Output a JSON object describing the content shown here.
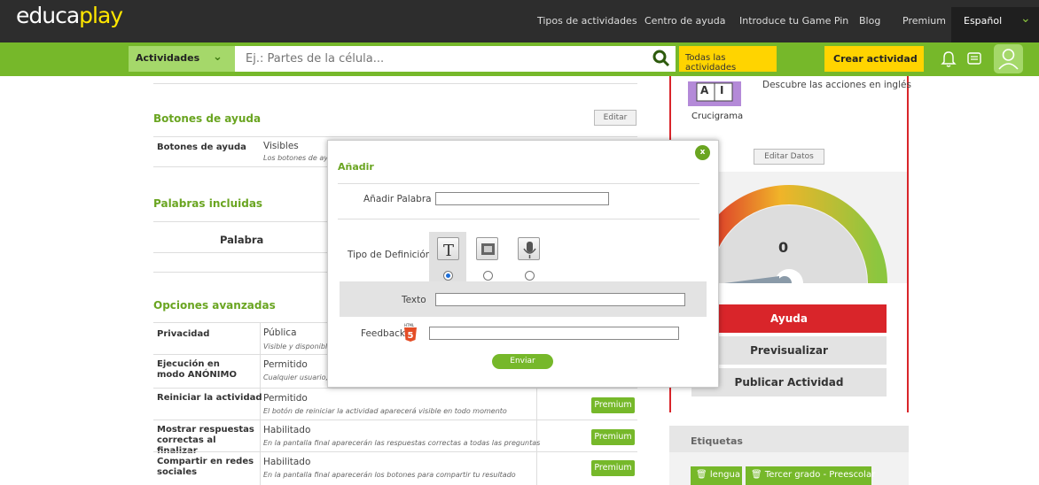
{
  "topbar": {
    "links": [
      "Tipos de actividades",
      "Centro de ayuda",
      "Introduce tu Game Pin",
      "Blog",
      "Premium"
    ],
    "language": "Español"
  },
  "navbar": {
    "logo_part1": "educa",
    "logo_part2": "play",
    "activities_label": "Actividades",
    "search_placeholder": "Ej.: Partes de la célula...",
    "all_activities": "Todas las actividades",
    "create_activity": "Crear actividad"
  },
  "help_section": {
    "title": "Botones de ayuda",
    "edit_label": "Editar",
    "row_label": "Botones de ayuda",
    "row_value": "Visibles",
    "row_desc": "Los botones de ayu"
  },
  "words_section": {
    "title": "Palabras incluidas",
    "column_header": "Palabra"
  },
  "advanced_section": {
    "title": "Opciones avanzadas",
    "premium_label": "Premium",
    "rows": [
      {
        "label": "Privacidad",
        "value": "Pública",
        "desc": "Visible y disponible"
      },
      {
        "label": "Ejecución en modo ANÓNIMO",
        "value": "Permitido",
        "desc": "Cualquier usuario, a"
      },
      {
        "label": "Reiniciar la actividad",
        "value": "Permitido",
        "desc": "El botón de reiniciar la actividad aparecerá visible en todo momento"
      },
      {
        "label": "Mostrar respuestas correctas al finalizar",
        "value": "Habilitado",
        "desc": "En la pantalla final aparecerán las respuestas correctas a todas las preguntas"
      },
      {
        "label": "Compartir en redes sociales",
        "value": "Habilitado",
        "desc": "En la pantalla final aparecerán los botones para compartir tu resultado"
      }
    ]
  },
  "right_panel": {
    "activity_desc": "Descubre las acciones en inglés",
    "activity_type": "Crucigrama",
    "edit_data": "Editar Datos",
    "gauge_value": "0",
    "help_btn": "Ayuda",
    "preview_btn": "Previsualizar",
    "publish_btn": "Publicar Actividad",
    "tags_title": "Etiquetas",
    "tags": [
      "lengua",
      "Tercer grado - Preescolar"
    ],
    "colors": {
      "red": "#d9252a",
      "green": "#76b82a"
    }
  },
  "modal": {
    "close_label": "x",
    "title": "Añadir",
    "add_word_label": "Añadir Palabra",
    "definition_type_label": "Tipo de Definición",
    "text_label": "Texto",
    "feedback_label": "Feedback",
    "submit_label": "Enviar",
    "definition_icons": [
      "text-T-icon",
      "image-icon",
      "microphone-icon"
    ],
    "selected_definition_index": 0
  },
  "puzzle_letters": [
    "A",
    "I"
  ]
}
